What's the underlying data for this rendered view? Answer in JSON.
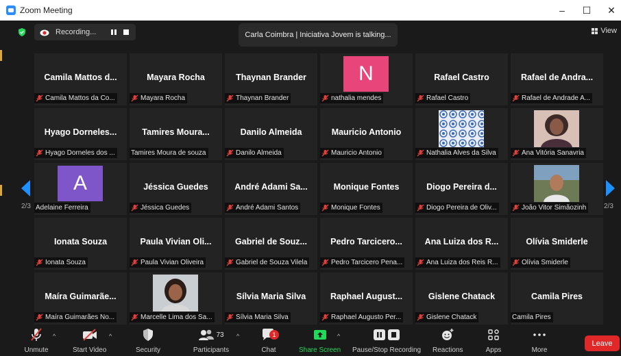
{
  "window": {
    "title": "Zoom Meeting",
    "controls": [
      "–",
      "☐",
      "✕"
    ]
  },
  "recording": {
    "label": "Recording..."
  },
  "talker": {
    "text": "Carla Coimbra | Iniciativa Jovem is talking..."
  },
  "view": {
    "label": "View"
  },
  "pager": {
    "left": "2/3",
    "right": "2/3"
  },
  "colors": {
    "accent_green": "#23d959",
    "leave_red": "#e02828",
    "muted_red": "#e0403a",
    "avatar_n": "#e8457a",
    "avatar_a": "#7f56c9"
  },
  "tiles": [
    {
      "name": "Camila Mattos d...",
      "label": "Camila Mattos da Co...",
      "muted": true
    },
    {
      "name": "Mayara Rocha",
      "label": "Mayara Rocha",
      "muted": true
    },
    {
      "name": "Thaynan Brander",
      "label": "Thaynan Brander",
      "muted": true
    },
    {
      "avatar": "N",
      "label": "nathalia mendes",
      "muted": true
    },
    {
      "name": "Rafael Castro",
      "label": "Rafael Castro",
      "muted": true
    },
    {
      "name": "Rafael de Andra...",
      "label": "Rafael de Andrade A...",
      "muted": true
    },
    {
      "name": "Hyago Dorneles...",
      "label": "Hyago Dorneles dos ...",
      "muted": true
    },
    {
      "name": "Tamires Moura...",
      "label": "Tamires Moura de souza",
      "muted": false
    },
    {
      "name": "Danilo Almeida",
      "label": "Danilo Almeida",
      "muted": true
    },
    {
      "name": "Mauricio Antonio",
      "label": "Mauricio Antonio",
      "muted": true
    },
    {
      "photo": "tile-pattern",
      "label": "Nathalia Alves da Silva",
      "muted": true
    },
    {
      "photo": "woman-portrait",
      "label": "Ana Vitória Sanavria",
      "muted": true
    },
    {
      "avatar": "A",
      "label": "Adelaine Ferreira",
      "muted": false
    },
    {
      "name": "Jéssica Guedes",
      "label": "Jéssica Guedes",
      "muted": true
    },
    {
      "name": "André Adami Sa...",
      "label": "André Adami Santos",
      "muted": true
    },
    {
      "name": "Monique Fontes",
      "label": "Monique Fontes",
      "muted": true
    },
    {
      "name": "Diogo Pereira d...",
      "label": "Diogo Pereira de Oliv...",
      "muted": true
    },
    {
      "photo": "man-outdoor",
      "label": "João Vitor Simãozinh",
      "muted": true
    },
    {
      "name": "Ionata Souza",
      "label": "Ionata Souza",
      "muted": true
    },
    {
      "name": "Paula Vivian Oli...",
      "label": "Paula Vivian Oliveira",
      "muted": true
    },
    {
      "name": "Gabriel de Souz...",
      "label": "Gabriel de Souza Vilela",
      "muted": true
    },
    {
      "name": "Pedro Tarcicero...",
      "label": "Pedro Tarcicero Pena...",
      "muted": true
    },
    {
      "name": "Ana Luiza dos R...",
      "label": "Ana Luiza dos Reis R...",
      "muted": true
    },
    {
      "name": "Olívia Smiderle",
      "label": "Olívia Smiderle",
      "muted": true
    },
    {
      "name": "Maíra Guimarãe...",
      "label": "Maíra Guimarães No...",
      "muted": true
    },
    {
      "photo": "woman-smiling",
      "label": "Marcelle Lima dos Sa...",
      "muted": true
    },
    {
      "name": "Sílvia Maria Silva",
      "label": "Sílvia Maria Silva",
      "muted": true
    },
    {
      "name": "Raphael August...",
      "label": "Raphael Augusto Per...",
      "muted": true
    },
    {
      "name": "Gislene Chatack",
      "label": "Gislene Chatack",
      "muted": true
    },
    {
      "name": "Camila Pires",
      "label": "Camila Pires",
      "muted": false
    }
  ],
  "toolbar": {
    "unmute": "Unmute",
    "start_video": "Start Video",
    "security": "Security",
    "participants": "Participants",
    "participants_count": "73",
    "chat": "Chat",
    "chat_badge": "1",
    "share_screen": "Share Screen",
    "pause_stop_recording": "Pause/Stop Recording",
    "reactions": "Reactions",
    "apps": "Apps",
    "more": "More",
    "leave": "Leave"
  }
}
